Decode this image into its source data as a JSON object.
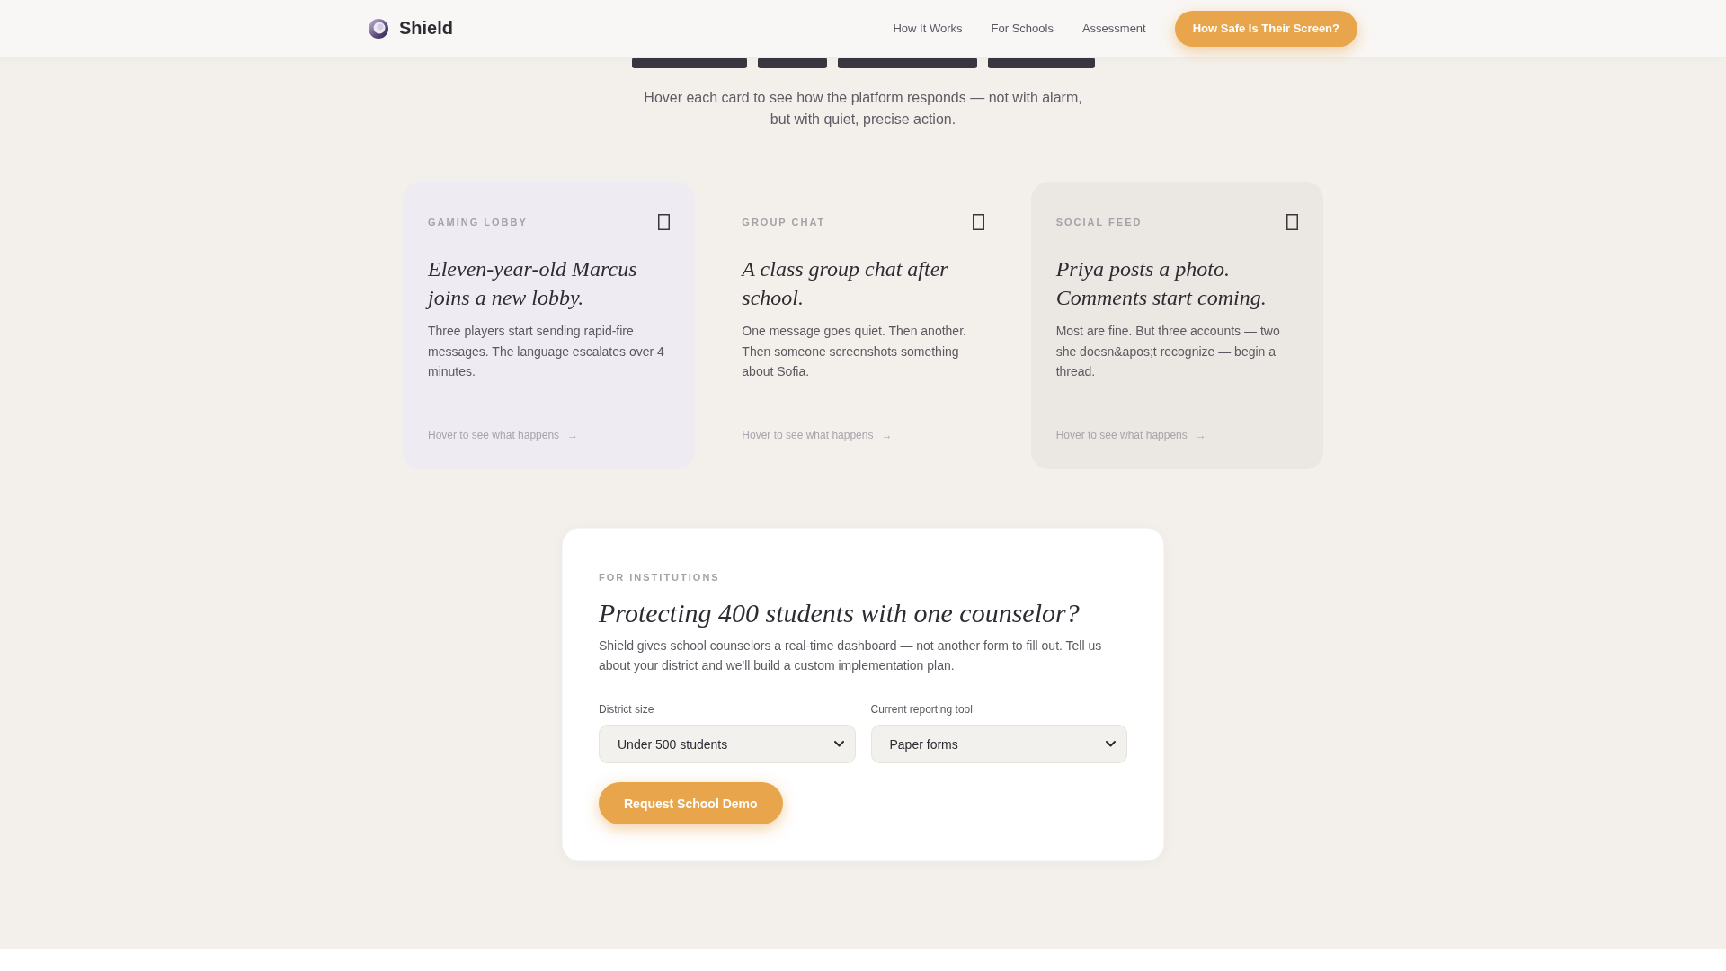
{
  "header": {
    "logo_text": "Shield",
    "nav_links": [
      "How It Works",
      "For Schools",
      "Assessment"
    ],
    "cta_button": "How Safe Is Their Screen?"
  },
  "intro": {
    "subtitle": "Hover each card to see how the platform responds — not with alarm, but with quiet, precise action."
  },
  "scenario_cards": [
    {
      "category": "GAMING LOBBY",
      "title": "Eleven-year-old Marcus joins a new lobby.",
      "description": "Three players start sending rapid-fire messages. The language escalates over 4 minutes.",
      "hint": "Hover to see what happens",
      "arrow": "→",
      "color": "#eeebf2"
    },
    {
      "category": "GROUP CHAT",
      "title": "A class group chat after school.",
      "description": "One message goes quiet. Then another. Then someone screenshots something about Sofia.",
      "hint": "Hover to see what happens",
      "arrow": "→",
      "color": "#f3f0ec"
    },
    {
      "category": "SOCIAL FEED",
      "title": "Priya posts a photo. Comments start coming.",
      "description": "Most are fine. But three accounts — two she doesn&apos;t recognize — begin a thread.",
      "hint": "Hover to see what happens",
      "arrow": "→",
      "color": "#ebe7e3"
    }
  ],
  "institutions": {
    "eyebrow": "FOR INSTITUTIONS",
    "heading": "Protecting 400 students with one counselor?",
    "description": "Shield gives school counselors a real-time dashboard — not another form to fill out. Tell us about your district and we'll build a custom implementation plan.",
    "fields": [
      {
        "label": "District size",
        "value": "Under 500 students"
      },
      {
        "label": "Current reporting tool",
        "value": "Paper forms"
      }
    ],
    "button": "Request School Demo"
  }
}
